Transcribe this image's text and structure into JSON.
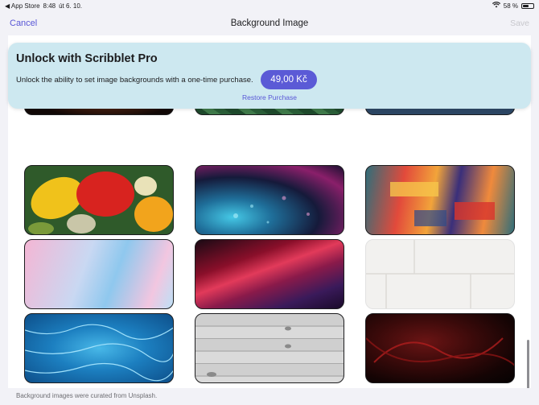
{
  "status_bar": {
    "back_app": "◀ App Store",
    "time": "8:48",
    "date": "út 6. 10.",
    "battery_percent": "58 %",
    "battery_level": 0.58
  },
  "nav": {
    "cancel": "Cancel",
    "title": "Background Image",
    "save": "Save"
  },
  "promo": {
    "title": "Unlock with Scribblet Pro",
    "description": "Unlock the ability to set image backgrounds with a one-time purchase.",
    "price": "49,00 Kč",
    "restore": "Restore Purchase"
  },
  "images": [
    "fire-embers",
    "green-leaves",
    "ocean-horizon",
    "autumn-leaves",
    "rain-drops-glass",
    "abstract-paint",
    "pink-blue-watercolor",
    "red-light-streaks",
    "white-brick-wall",
    "blue-water-caustics",
    "gray-wood-planks",
    "dark-red-swirl"
  ],
  "footer": "Background images were curated from Unsplash.",
  "colors": {
    "accent": "#5856d6",
    "promo_bg": "#cde8f0",
    "button": "#5b5ad6"
  }
}
